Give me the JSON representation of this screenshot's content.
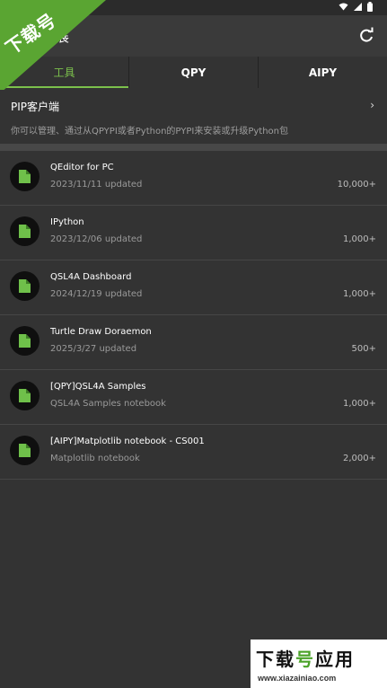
{
  "appbar": {
    "title": "展"
  },
  "tabs": [
    {
      "label": "工具"
    },
    {
      "label": "QPY"
    },
    {
      "label": "AIPY"
    }
  ],
  "pip": {
    "title": "PIP客户端",
    "description": "你可以管理、通过从QPYPI或者Python的PYPI来安装或升级Python包",
    "chevron": "›"
  },
  "items": [
    {
      "title": "QEditor for PC",
      "subtitle": "2023/11/11 updated",
      "count": "10,000+"
    },
    {
      "title": "IPython",
      "subtitle": "2023/12/06 updated",
      "count": "1,000+"
    },
    {
      "title": "QSL4A Dashboard",
      "subtitle": "2024/12/19 updated",
      "count": "1,000+"
    },
    {
      "title": "Turtle Draw Doraemon",
      "subtitle": "2025/3/27 updated",
      "count": "500+"
    },
    {
      "title": "[QPY]QSL4A Samples",
      "subtitle": "QSL4A Samples notebook",
      "count": "1,000+"
    },
    {
      "title": "[AIPY]Matplotlib notebook - CS001",
      "subtitle": "Matplotlib notebook",
      "count": "2,000+"
    }
  ],
  "watermark": {
    "corner_text": "下载号",
    "brand_part1": "下载",
    "brand_part2": "号",
    "brand_part3": "应用",
    "url": "www.xiazainiao.com"
  },
  "colors": {
    "accent": "#7cc14c",
    "background": "#333333",
    "appbar": "#3a3a3a"
  },
  "icons": {
    "refresh": "refresh-icon",
    "file": "file-icon",
    "wifi": "wifi-icon",
    "signal": "signal-icon",
    "battery": "battery-icon"
  }
}
